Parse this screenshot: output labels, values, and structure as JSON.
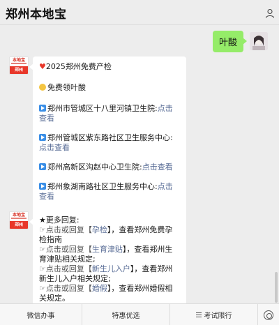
{
  "header": {
    "title": "郑州本地宝",
    "menu_icon": "ellipsis-icon",
    "profile_icon": "person-icon"
  },
  "messages": {
    "me": {
      "text": "叶酸"
    },
    "bot1": {
      "avatar": {
        "top": "本地宝",
        "bottom": "郑州"
      },
      "line1": "2025郑州免费产检",
      "line2": "免费领叶酸",
      "items": [
        {
          "label": "郑州市管城区十八里河镇卫生院:",
          "link": "点击查看"
        },
        {
          "label": "郑州管城区紫东路社区卫生服务中心:",
          "link": "点击查看"
        },
        {
          "label": "郑州高新区沟赵中心卫生院:",
          "link": "点击查看"
        },
        {
          "label": "郑州象湖南路社区卫生服务中心:",
          "link": "点击查看"
        }
      ]
    },
    "bot2": {
      "avatar": {
        "top": "本地宝",
        "bottom": "郑州"
      },
      "intro": "★更多回复:",
      "replies": [
        {
          "prefix": "☞点击或回复【",
          "keyword": "孕检",
          "suffix": "】，查看郑州免费孕检指南"
        },
        {
          "prefix": "☞点击或回复【",
          "keyword": "生育津贴",
          "suffix": "】，查看郑州生育津贴相关规定;"
        },
        {
          "prefix": "☞点击或回复【",
          "keyword": "新生儿入户",
          "suffix": "】，查看郑州新生儿入户相关规定;"
        },
        {
          "prefix": "☞点击或回复【",
          "keyword": "婚假",
          "suffix": "】，查看郑州婚假相关规定。"
        }
      ]
    }
  },
  "tabbar": {
    "tabs": [
      "微信办事",
      "特惠优选",
      "考试限行"
    ],
    "keyboard_icon": "keyboard-icon"
  },
  "colors": {
    "accent_link": "#576b95",
    "my_bubble": "#95ec69",
    "brand_red": "#e8372a"
  }
}
